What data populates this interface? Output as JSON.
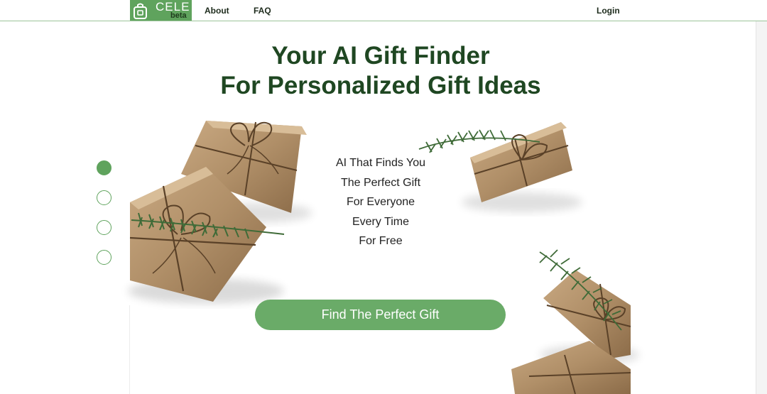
{
  "nav": {
    "logo_text": "CELE",
    "logo_badge": "beta",
    "links": {
      "about": "About",
      "faq": "FAQ",
      "login": "Login"
    }
  },
  "hero": {
    "headline_line1": "Your AI Gift Finder",
    "headline_line2": "For Personalized Gift Ideas",
    "tagline": [
      "AI That Finds You",
      "The Perfect Gift",
      "For Everyone",
      "Every Time",
      "For Free"
    ],
    "cta_label": "Find The Perfect Gift"
  },
  "carousel": {
    "slide_count": 4,
    "active_index": 0
  },
  "colors": {
    "brand_green": "#5fa35d",
    "cta_green": "#6aab68",
    "headline_green": "#1f4722",
    "kraft_paper": "#b08f68",
    "twine": "#5a4128",
    "pine": "#3f6b38"
  },
  "icons": {
    "logo": "gift-bag-icon"
  }
}
